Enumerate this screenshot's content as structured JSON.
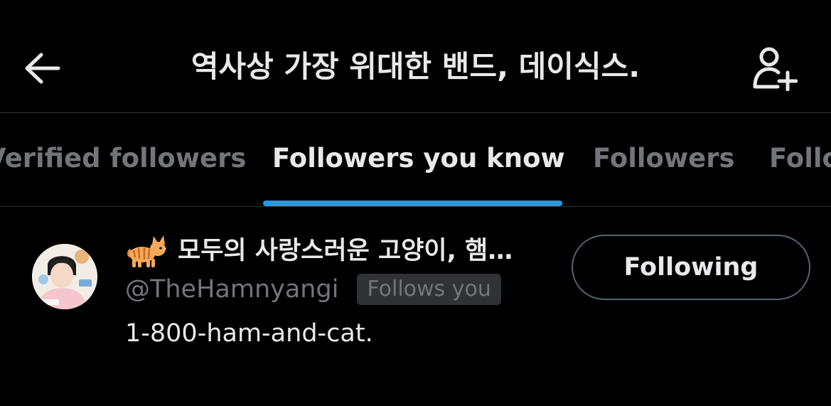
{
  "header": {
    "title": "역사상 가장 위대한 밴드, 데이식스.",
    "back_icon": "arrow-left-icon",
    "add_user_icon": "person-add-icon"
  },
  "tabs": [
    {
      "label": "Verified followers",
      "active": false
    },
    {
      "label": "Followers you know",
      "active": true
    },
    {
      "label": "Followers",
      "active": false
    },
    {
      "label": "Following",
      "active": false
    }
  ],
  "users": [
    {
      "emoji_icon": "cat-icon",
      "display_name": "모두의 사랑스러운 고양이, 햄…",
      "handle": "@TheHamnyangi",
      "follows_you_badge": "Follows you",
      "bio": "1-800-ham-and-cat.",
      "follow_button_label": "Following"
    }
  ],
  "colors": {
    "background": "#000000",
    "text_primary": "#e7e9ea",
    "text_secondary": "#71767b",
    "accent": "#1d9bf0",
    "divider": "#2f3336"
  }
}
